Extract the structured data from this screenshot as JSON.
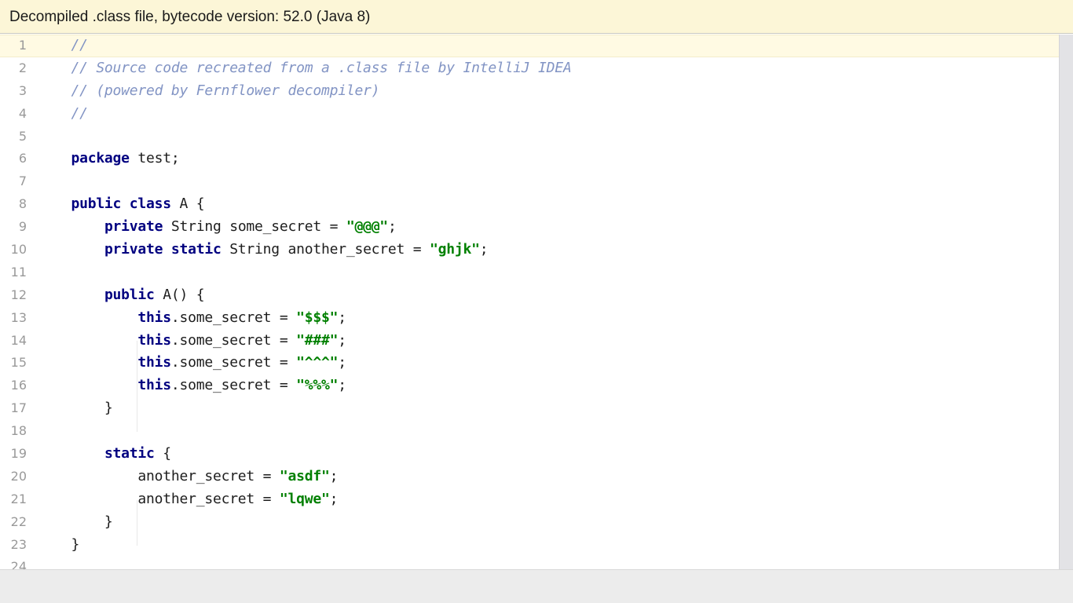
{
  "banner": {
    "text": "Decompiled .class file, bytecode version: 52.0 (Java 8)",
    "background_color": "#fcf6d7",
    "text_color": "#1a1a1a"
  },
  "editor": {
    "language": "java",
    "caret_line": 1,
    "colors": {
      "keyword": "#000080",
      "string": "#008000",
      "comment": "#8294c4",
      "plain": "#1d1d1d",
      "line_number": "#999999",
      "caret_line_background": "#fffae3",
      "background": "#ffffff",
      "indent_guide": "#e8e8e8",
      "scrollbar_track": "#e3e3e6",
      "bottom_bar": "#ececec"
    },
    "lines": [
      {
        "n": "1",
        "tokens": [
          {
            "t": "    ",
            "c": "pln"
          },
          {
            "t": "//",
            "c": "cmt"
          }
        ]
      },
      {
        "n": "2",
        "tokens": [
          {
            "t": "    ",
            "c": "pln"
          },
          {
            "t": "// Source code recreated from a .class file by IntelliJ IDEA",
            "c": "cmt"
          }
        ]
      },
      {
        "n": "3",
        "tokens": [
          {
            "t": "    ",
            "c": "pln"
          },
          {
            "t": "// (powered by Fernflower decompiler)",
            "c": "cmt"
          }
        ]
      },
      {
        "n": "4",
        "tokens": [
          {
            "t": "    ",
            "c": "pln"
          },
          {
            "t": "//",
            "c": "cmt"
          }
        ]
      },
      {
        "n": "5",
        "tokens": []
      },
      {
        "n": "6",
        "tokens": [
          {
            "t": "    ",
            "c": "pln"
          },
          {
            "t": "package",
            "c": "kw"
          },
          {
            "t": " test;",
            "c": "pln"
          }
        ]
      },
      {
        "n": "7",
        "tokens": []
      },
      {
        "n": "8",
        "tokens": [
          {
            "t": "    ",
            "c": "pln"
          },
          {
            "t": "public class",
            "c": "kw"
          },
          {
            "t": " A {",
            "c": "pln"
          }
        ]
      },
      {
        "n": "9",
        "tokens": [
          {
            "t": "        ",
            "c": "pln"
          },
          {
            "t": "private",
            "c": "kw"
          },
          {
            "t": " String some_secret = ",
            "c": "pln"
          },
          {
            "t": "\"@@@\"",
            "c": "str"
          },
          {
            "t": ";",
            "c": "pln"
          }
        ]
      },
      {
        "n": "10",
        "tokens": [
          {
            "t": "        ",
            "c": "pln"
          },
          {
            "t": "private static",
            "c": "kw"
          },
          {
            "t": " String another_secret = ",
            "c": "pln"
          },
          {
            "t": "\"ghjk\"",
            "c": "str"
          },
          {
            "t": ";",
            "c": "pln"
          }
        ]
      },
      {
        "n": "11",
        "tokens": []
      },
      {
        "n": "12",
        "tokens": [
          {
            "t": "        ",
            "c": "pln"
          },
          {
            "t": "public",
            "c": "kw"
          },
          {
            "t": " A() {",
            "c": "pln"
          }
        ]
      },
      {
        "n": "13",
        "tokens": [
          {
            "t": "            ",
            "c": "pln"
          },
          {
            "t": "this",
            "c": "kw"
          },
          {
            "t": ".some_secret = ",
            "c": "pln"
          },
          {
            "t": "\"$$$\"",
            "c": "str"
          },
          {
            "t": ";",
            "c": "pln"
          }
        ]
      },
      {
        "n": "14",
        "tokens": [
          {
            "t": "            ",
            "c": "pln"
          },
          {
            "t": "this",
            "c": "kw"
          },
          {
            "t": ".some_secret = ",
            "c": "pln"
          },
          {
            "t": "\"###\"",
            "c": "str"
          },
          {
            "t": ";",
            "c": "pln"
          }
        ]
      },
      {
        "n": "15",
        "tokens": [
          {
            "t": "            ",
            "c": "pln"
          },
          {
            "t": "this",
            "c": "kw"
          },
          {
            "t": ".some_secret = ",
            "c": "pln"
          },
          {
            "t": "\"^^^\"",
            "c": "str"
          },
          {
            "t": ";",
            "c": "pln"
          }
        ]
      },
      {
        "n": "16",
        "tokens": [
          {
            "t": "            ",
            "c": "pln"
          },
          {
            "t": "this",
            "c": "kw"
          },
          {
            "t": ".some_secret = ",
            "c": "pln"
          },
          {
            "t": "\"%%%\"",
            "c": "str"
          },
          {
            "t": ";",
            "c": "pln"
          }
        ]
      },
      {
        "n": "17",
        "tokens": [
          {
            "t": "        }",
            "c": "pln"
          }
        ]
      },
      {
        "n": "18",
        "tokens": []
      },
      {
        "n": "19",
        "tokens": [
          {
            "t": "        ",
            "c": "pln"
          },
          {
            "t": "static",
            "c": "kw"
          },
          {
            "t": " {",
            "c": "pln"
          }
        ]
      },
      {
        "n": "20",
        "tokens": [
          {
            "t": "            another_secret = ",
            "c": "pln"
          },
          {
            "t": "\"asdf\"",
            "c": "str"
          },
          {
            "t": ";",
            "c": "pln"
          }
        ]
      },
      {
        "n": "21",
        "tokens": [
          {
            "t": "            another_secret = ",
            "c": "pln"
          },
          {
            "t": "\"lqwe\"",
            "c": "str"
          },
          {
            "t": ";",
            "c": "pln"
          }
        ]
      },
      {
        "n": "22",
        "tokens": [
          {
            "t": "        }",
            "c": "pln"
          }
        ]
      },
      {
        "n": "23",
        "tokens": [
          {
            "t": "    }",
            "c": "pln"
          }
        ]
      },
      {
        "n": "24",
        "tokens": []
      }
    ]
  }
}
